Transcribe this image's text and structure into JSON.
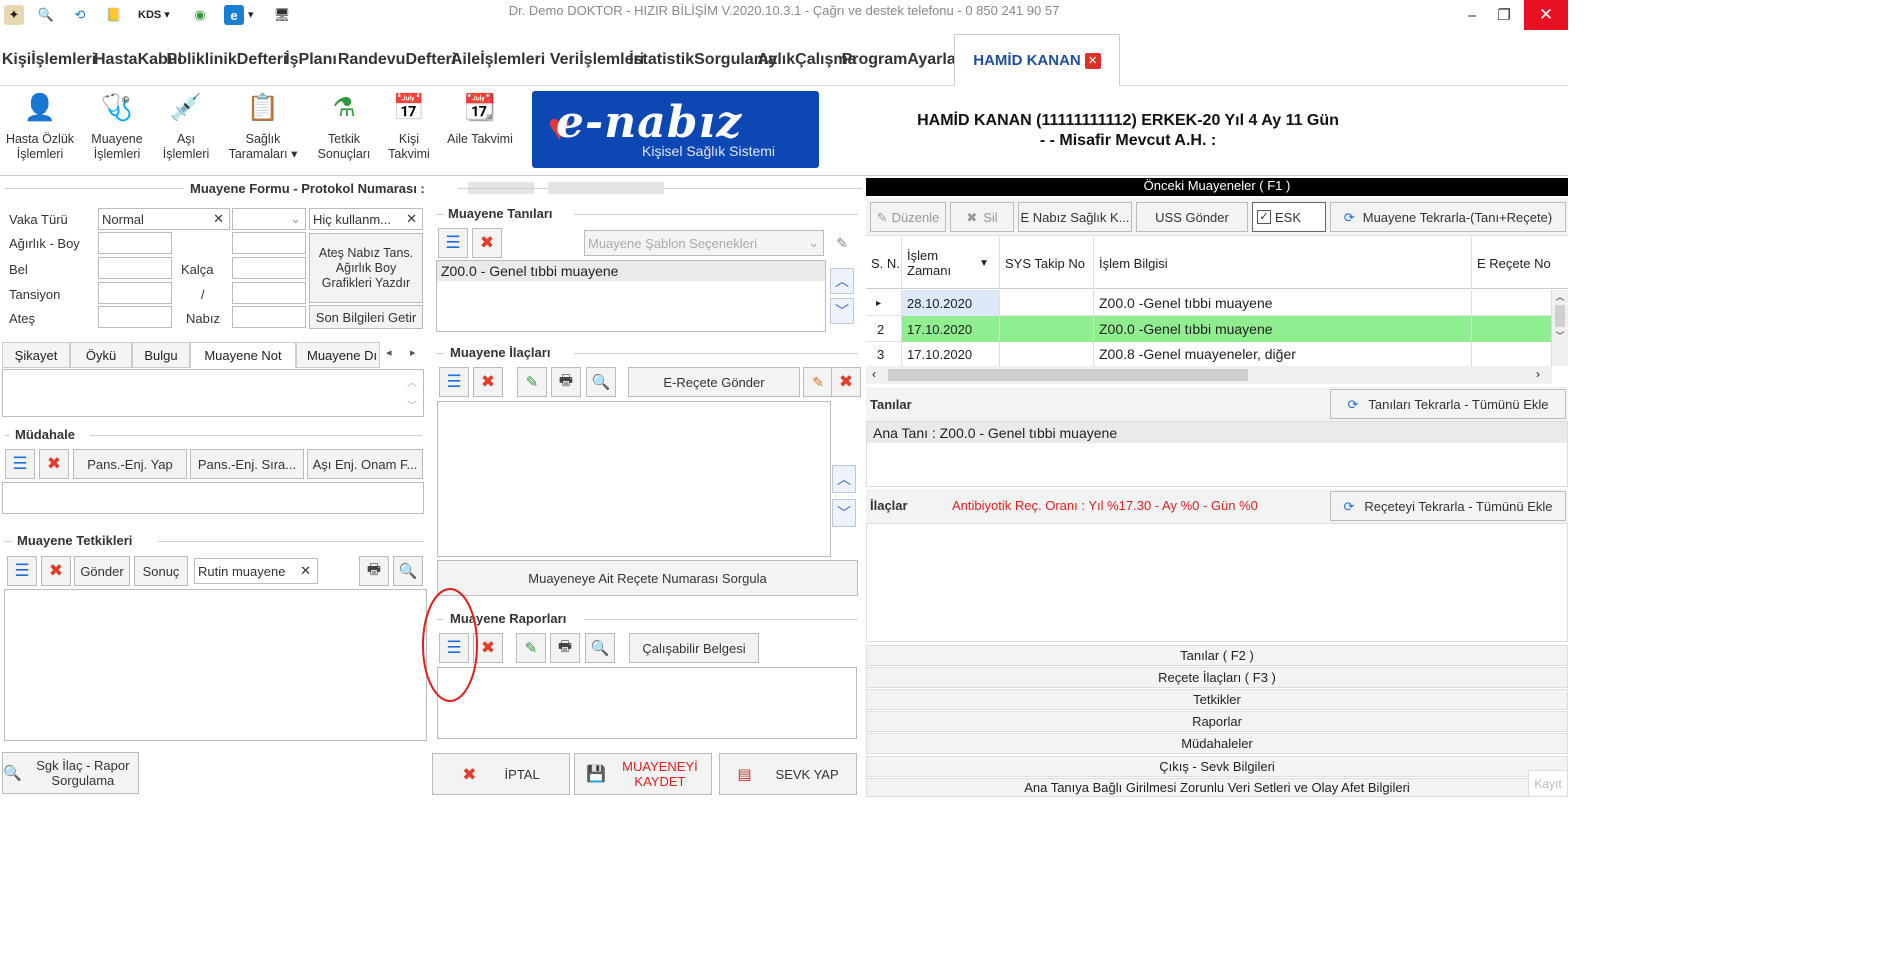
{
  "window": {
    "title": "Dr. Demo DOKTOR - HIZIR BİLİŞİM V.2020.10.3.1 - Çağrı ve destek telefonu - 0 850 241 90 57",
    "kds_label": "KDS"
  },
  "menu": {
    "items": [
      {
        "line1": "Kişi",
        "line2": "İşlemleri"
      },
      {
        "line1": "Hasta",
        "line2": "Kabul"
      },
      {
        "line1": "Poliklinik",
        "line2": "Defteri"
      },
      {
        "line1": "İş",
        "line2": "Planı"
      },
      {
        "line1": "Randevu",
        "line2": "Defteri"
      },
      {
        "line1": "Aile",
        "line2": "İşlemleri"
      },
      {
        "line1": "Veri",
        "line2": "İşlemleri"
      },
      {
        "line1": "İstatistik",
        "line2": "Sorgulama"
      },
      {
        "line1": "Aylık",
        "line2": "Çalışma"
      },
      {
        "line1": "Program",
        "line2": "Ayarları"
      }
    ],
    "active_tab": "HAMİD KANAN"
  },
  "toolbar": {
    "tools": [
      {
        "line1": "Hasta Özlük",
        "line2": "İşlemleri"
      },
      {
        "line1": "Muayene",
        "line2": "İşlemleri"
      },
      {
        "line1": "Aşı",
        "line2": "İşlemleri"
      },
      {
        "line1": "Sağlık",
        "line2": "Taramaları ▾"
      },
      {
        "line1": "Tetkik",
        "line2": "Sonuçları"
      },
      {
        "line1": "Kişi",
        "line2": "Takvimi"
      },
      {
        "line1": "Aile Takvimi",
        "line2": ""
      }
    ],
    "enabiz_logo": "e-nabız",
    "enabiz_sub": "Kişisel Sağlık Sistemi"
  },
  "patient": {
    "line1": "HAMİD KANAN (11111111112)  ERKEK-20 Yıl 4 Ay 11 Gün",
    "line2": "-  - Misafir Mevcut A.H. :"
  },
  "form": {
    "title": "Muayene Formu - Protokol Numarası :",
    "vaka_label": "Vaka Türü",
    "vaka_value": "Normal",
    "hic_value": "Hiç kullanm...",
    "agirlik_label": "Ağırlık - Boy",
    "bel_label": "Bel",
    "kalca_label": "Kalça",
    "tansiyon_label": "Tansiyon",
    "slash": "/",
    "ates_label": "Ateş",
    "nabiz_label": "Nabız",
    "graf_btn": "Ateş Nabız Tans. Ağırlık Boy Grafikleri Yazdır",
    "son_btn": "Son Bilgileri Getir"
  },
  "note_tabs": [
    "Şikayet",
    "Öykü",
    "Bulgu",
    "Muayene Not",
    "Muayene Dı"
  ],
  "mudahale": {
    "title": "Müdahale",
    "btn1": "Pans.-Enj. Yap",
    "btn2": "Pans.-Enj. Sıra...",
    "btn3": "Aşı Enj. Onam F..."
  },
  "tetkik": {
    "title": "Muayene Tetkikleri",
    "gonder": "Gönder",
    "sonuc": "Sonuç",
    "rutin": "Rutin muayene"
  },
  "sgk_btn": "Sgk İlaç - Rapor Sorgulama",
  "tanilar": {
    "title": "Muayene Tanıları",
    "template_placeholder": "Muayene Şablon Seçenekleri",
    "item": "Z00.0 - Genel tıbbi muayene"
  },
  "ilaclar": {
    "title": "Muayene İlaçları",
    "erecete_btn": "E-Reçete Gönder",
    "sorgula_btn": "Muayeneye Ait Reçete Numarası Sorgula"
  },
  "raporlar": {
    "title": "Muayene Raporları",
    "calisabilir_btn": "Çalışabilir Belgesi"
  },
  "bottom_buttons": {
    "iptal": "İPTAL",
    "kaydet": "MUAYENEYİ KAYDET",
    "sevk": "SEVK YAP"
  },
  "right": {
    "header": "Önceki Muayeneler ( F1 )",
    "duzenle": "Düzenle",
    "sil": "Sil",
    "enabiz_btn": "E Nabız Sağlık K...",
    "uss_btn": "USS Gönder",
    "esk_label": "ESK",
    "tekrar_btn": "Muayene Tekrarla-(Tanı+Reçete)",
    "columns": [
      "S. N.",
      "İşlem Zamanı",
      "SYS Takip No",
      "İşlem Bilgisi",
      "E Reçete No"
    ],
    "rows": [
      {
        "sn": "",
        "date": "28.10.2020",
        "sys": "",
        "info": "Z00.0 -Genel tıbbi muayene",
        "erecete": ""
      },
      {
        "sn": "2",
        "date": "17.10.2020",
        "sys": "",
        "info": "Z00.0 -Genel tıbbi muayene",
        "erecete": ""
      },
      {
        "sn": "3",
        "date": "17.10.2020",
        "sys": "",
        "info": "Z00.8 -Genel muayeneler, diğer",
        "erecete": ""
      }
    ],
    "tanilar_label": "Tanılar",
    "tanilar_tekrar_btn": "Tanıları Tekrarla - Tümünü Ekle",
    "ana_tani": "Ana Tanı : Z00.0 - Genel tıbbi muayene",
    "ilaclar_label": "İlaçlar",
    "antibiyotik": "Antibiyotik Reç. Oranı : Yıl %17.30  - Ay %0  - Gün %0",
    "recete_tekrar_btn": "Reçeteyi Tekrarla - Tümünü Ekle",
    "sections": [
      "Tanılar ( F2 )",
      "Reçete İlaçları ( F3 )",
      "Tetkikler",
      "Raporlar",
      "Müdahaleler",
      "Çıkış - Sevk Bilgileri",
      "Ana Tanıya Bağlı Girilmesi Zorunlu Veri Setleri ve Olay Afet Bilgileri"
    ],
    "kayit_label": "Kayıt"
  },
  "colors": {
    "accent_blue": "#1e6fd9",
    "delete_red": "#e13d2b",
    "highlight_green": "#90ee90",
    "annotation_red": "#e01e1e"
  }
}
